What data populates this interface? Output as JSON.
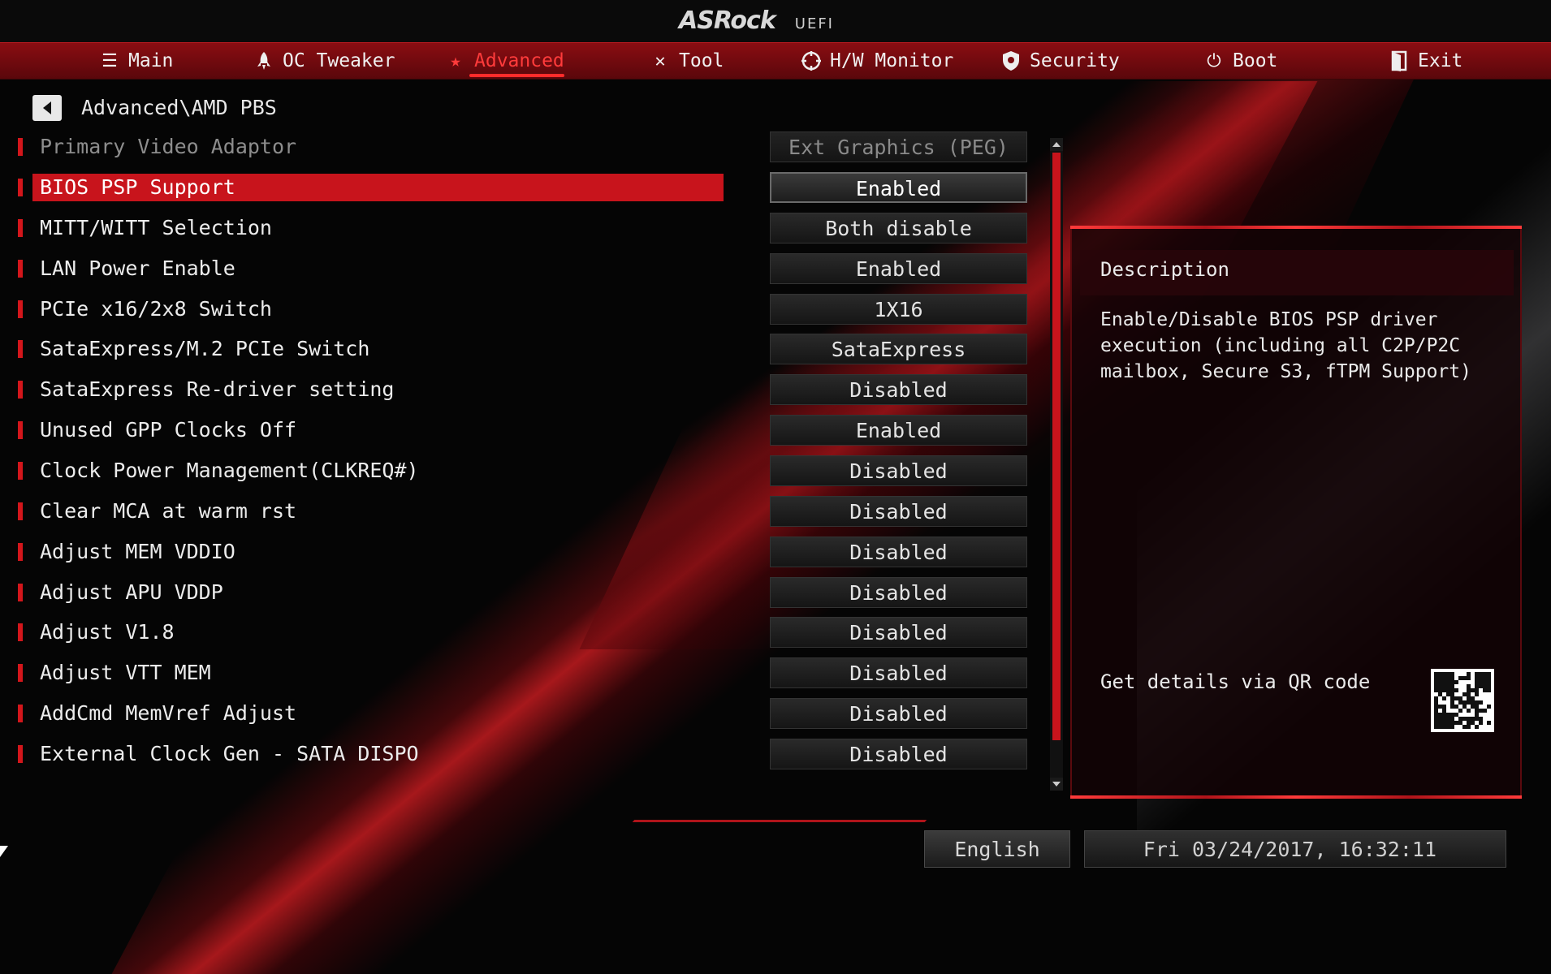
{
  "header": {
    "logo": "ASRock",
    "logo_sub": "UEFI"
  },
  "tabs": [
    {
      "label": "Main",
      "icon": "list-icon"
    },
    {
      "label": "OC Tweaker",
      "icon": "rocket-icon"
    },
    {
      "label": "Advanced",
      "icon": "star-icon",
      "active": true
    },
    {
      "label": "Tool",
      "icon": "tools-icon"
    },
    {
      "label": "H/W Monitor",
      "icon": "monitor-icon"
    },
    {
      "label": "Security",
      "icon": "shield-icon"
    },
    {
      "label": "Boot",
      "icon": "power-icon"
    },
    {
      "label": "Exit",
      "icon": "exit-door-icon"
    }
  ],
  "breadcrumb": "Advanced\\AMD PBS",
  "settings": [
    {
      "label": "Primary Video Adaptor",
      "value": "Ext Graphics (PEG)",
      "state": "disabled"
    },
    {
      "label": "BIOS PSP Support",
      "value": "Enabled",
      "state": "selected"
    },
    {
      "label": "MITT/WITT Selection",
      "value": "Both disable"
    },
    {
      "label": "LAN Power Enable",
      "value": "Enabled"
    },
    {
      "label": "PCIe x16/2x8 Switch",
      "value": "1X16"
    },
    {
      "label": "SataExpress/M.2 PCIe Switch",
      "value": "SataExpress"
    },
    {
      "label": "SataExpress Re-driver setting",
      "value": "Disabled"
    },
    {
      "label": "Unused GPP Clocks Off",
      "value": "Enabled"
    },
    {
      "label": "Clock Power Management(CLKREQ#)",
      "value": "Disabled"
    },
    {
      "label": "Clear MCA at warm rst",
      "value": "Disabled"
    },
    {
      "label": "Adjust MEM VDDIO",
      "value": "Disabled"
    },
    {
      "label": "Adjust APU VDDP",
      "value": "Disabled"
    },
    {
      "label": "Adjust V1.8",
      "value": "Disabled"
    },
    {
      "label": "Adjust VTT MEM",
      "value": "Disabled"
    },
    {
      "label": "AddCmd MemVref  Adjust",
      "value": "Disabled"
    },
    {
      "label": "External Clock Gen - SATA DISPO",
      "value": "Disabled"
    }
  ],
  "description": {
    "title": "Description",
    "text": "Enable/Disable BIOS PSP driver\nexecution (including all C2P/P2C\nmailbox, Secure S3, fTPM Support)",
    "qr_label": "Get details via QR code"
  },
  "footer": {
    "language": "English",
    "datetime": "Fri 03/24/2017, 16:32:11"
  },
  "colors": {
    "accent": "#c8141c",
    "tab_bar": "#7a0b10",
    "active_tab": "#ff3b3b"
  }
}
